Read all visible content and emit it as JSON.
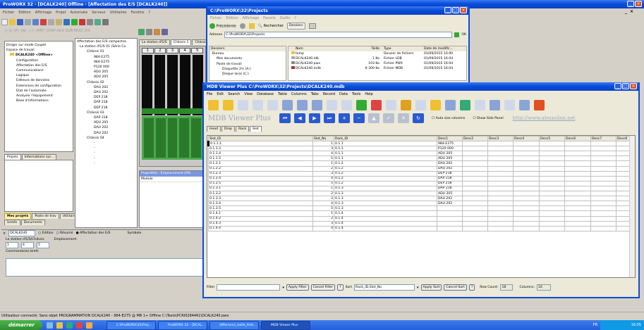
{
  "proworx": {
    "title": "ProWORX 32 - [DCALK240] Offline - [Affectation des E/S [DCALK240]]",
    "menu": [
      "Fichier",
      "Edition",
      "Affichage",
      "Projet",
      "Automate",
      "Serveur",
      "Utilitaires",
      "Fenêtre",
      "?"
    ],
    "toolbar2": [
      "-|- |[- |P|- |N|- -(-) -|HRT -|CMP ADD SUB MULT DIV"
    ],
    "left_tree": [
      "Diriger sur mode Couplé",
      "Espace de travail",
      "DCALK240 <Offline>",
      "Configuration",
      "Affectation des E/S",
      "Communications",
      "Logique",
      "Editeurs de données",
      "Extensions de configuration",
      "Etat de l'automate",
      "Analyser l'équipement",
      "Base d'informations"
    ],
    "left_tabs": [
      "Projets",
      "Informations sur..."
    ],
    "left_bottom_tabs": [
      "Mes projets",
      "Poste de trav",
      "Utilitaires",
      "Unités",
      "Documents"
    ],
    "io_tree_header": [
      "Affectation des E/S compactes",
      "La station d'E/S 01 (Série Co"
    ],
    "io_tree": [
      "Châssis 01",
      "984-E275",
      "984-E275",
      "P120 000",
      "ADU 205",
      "ADU 205",
      "Châssis 02",
      "DAU 202",
      "DAU 202",
      "DEP 218",
      "DAP 218",
      "DEP 218",
      "Châssis 03",
      "DAP 218",
      "ADU 205",
      "DAU 202",
      "DAU 202",
      "Châssis 04",
      "-",
      "-",
      "-",
      "-",
      "-"
    ],
    "rack_tabs": [
      "La station d'E/S",
      "Châssis 1",
      "Châssis 2"
    ],
    "rack_numbers": [
      "1",
      "2",
      "3",
      "4",
      "5"
    ],
    "prop_title": "Propriétés - Emplacement (05)",
    "prop_row": "Module",
    "bottom": {
      "item": "DCALK240",
      "radios": [
        "Edition",
        "Résumé",
        "Affectation des E/S"
      ],
      "col2": "Symbole",
      "station_label": "La station d'E/S/Châssis",
      "slot_label": "Emplacement",
      "station_val": "1",
      "chassis_val": "4",
      "slot_val": "5",
      "comments_label": "Commentaires brefs"
    },
    "status": "Utilisateur connecté: Sans objet   PROGRAMMATION  DCALK240 - 984-E275 @ MB 1+ Offline  C:\\Tests\\PCRI0284461\\DCALK240.pwx"
  },
  "explorer": {
    "title": "C:\\ProWORX\\32\\Projects",
    "menu": [
      "Fichier",
      "Edition",
      "Affichage",
      "Favoris",
      "Outils",
      "?"
    ],
    "back": "Précédente",
    "search": "Rechercher",
    "folders": "Dossiers",
    "address_label": "Adresse",
    "address": "C:\\ProWORX\\32\\Projects",
    "go": "OK",
    "folders_header": "Dossiers",
    "tree": [
      "Bureau",
      "Mes documents",
      "Poste de travail",
      "Disquette 3½ (A:)",
      "Disque local (C:)"
    ],
    "columns": [
      "Nom",
      "Taille",
      "Type",
      "Date de modific..."
    ],
    "files": [
      {
        "name": "temp",
        "size": "",
        "type": "Dossier de fichiers",
        "date": "01/09/2015 16:00"
      },
      {
        "name": "DCALK240.ldb",
        "size": "1 Ko",
        "type": "Fichier LDB",
        "date": "01/09/2015 16:04"
      },
      {
        "name": "DCALK240.pwx",
        "size": "103 Ko",
        "type": "Fichier PWX",
        "date": "01/09/2015 16:04"
      },
      {
        "name": "DCALK240.mdb",
        "size": "8 300 Ko",
        "type": "Fichier MDB",
        "date": "01/09/2015 16:04"
      }
    ]
  },
  "mdb": {
    "title": "MDB Viewer Plus C:\\ProWORX\\32\\Projects\\DCALK240.mdb",
    "menu": [
      "File",
      "Edit",
      "Search",
      "View",
      "Database",
      "Table",
      "Columns",
      "Tabs",
      "Record",
      "Data",
      "Tools",
      "Help"
    ],
    "brand": "MDB Viewer Plus",
    "auto_size": "Auto size columns",
    "side_panel": "Show Side Panel",
    "url": "http://www.alexnolan.net",
    "tabs": [
      "Head",
      "Drop",
      "Rack",
      "Slot"
    ],
    "columns": [
      "Slot_ID",
      "Slot_No",
      "Rack_ID",
      "Desc1",
      "Desc2",
      "Desc3",
      "Desc4",
      "Desc5",
      "Desc6",
      "Desc7",
      "Desc8"
    ],
    "rows": [
      [
        "0.1.1.1",
        "1",
        "0.1.1",
        "984-E275"
      ],
      [
        "0.1.1.3",
        "3",
        "0.1.1",
        "P120 000"
      ],
      [
        "0.1.1.4",
        "4",
        "0.1.1",
        "ADU 205"
      ],
      [
        "0.1.1.5",
        "5",
        "0.1.1",
        "ADU 205"
      ],
      [
        "0.1.2.1",
        "1",
        "0.1.2",
        "DAU 202"
      ],
      [
        "0.1.2.2",
        "2",
        "0.1.2",
        "DAU 202"
      ],
      [
        "0.1.2.3",
        "3",
        "0.1.2",
        "DEP 218"
      ],
      [
        "0.1.2.4",
        "4",
        "0.1.2",
        "DAP 218"
      ],
      [
        "0.1.2.5",
        "5",
        "0.1.2",
        "DEP 218"
      ],
      [
        "0.1.3.1",
        "1",
        "0.1.3",
        "DAP 218"
      ],
      [
        "0.1.3.2",
        "2",
        "0.1.3",
        "ADU 205"
      ],
      [
        "0.1.3.3",
        "3",
        "0.1.3",
        "DAU 202"
      ],
      [
        "0.1.3.4",
        "4",
        "0.1.3",
        "DAU 202"
      ],
      [
        "0.1.3.5",
        "5",
        "0.1.3",
        ""
      ],
      [
        "0.1.4.1",
        "1",
        "0.1.4",
        ""
      ],
      [
        "0.1.4.2",
        "2",
        "0.1.4",
        ""
      ],
      [
        "0.1.4.3",
        "3",
        "0.1.4",
        ""
      ],
      [
        "0.1.4.4",
        "4",
        "0.1.4",
        ""
      ]
    ],
    "filter_label": "Filter",
    "apply_filter": "Apply Filter",
    "cancel_filter": "Cancel Filter",
    "help": "?",
    "sort_label": "Sort",
    "sort_value": "Rack_ID,Slot_No",
    "apply_sort": "Apply Sort",
    "cancel_sort": "Cancel Sort",
    "row_count_label": "Row Count:",
    "row_count": "18",
    "columns_label": "Columns:",
    "columns_count": "16"
  },
  "taskbar": {
    "start": "démarrer",
    "buttons": [
      "C:\\ProWORX\\32\\Proj...",
      "ProWORX 32 - [DCAL...",
      "difference_taille_fichi...",
      "MDB Viewer Plus"
    ],
    "lang": "FR",
    "clock": "16:05"
  }
}
